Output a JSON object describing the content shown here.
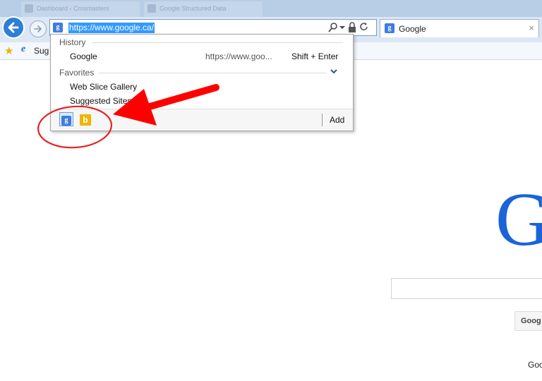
{
  "browser": {
    "background_tabs": [
      "Dashboard ‹ Cmsmasters",
      "Google Structured Data"
    ],
    "active_tab": {
      "title": "Google",
      "close_symbol": "×"
    },
    "address_bar": {
      "url": "https://www.google.ca/"
    },
    "favorites_bar": {
      "label": "Sug"
    }
  },
  "dropdown": {
    "history_header": "History",
    "history_item": {
      "label": "Google",
      "url": "https://www.goo...",
      "shortcut": "Shift + Enter"
    },
    "favorites_header": "Favorites",
    "favorites_items": [
      "Web Slice Gallery",
      "Suggested Sites"
    ],
    "add_label": "Add",
    "providers": [
      {
        "name": "google",
        "glyph": "g"
      },
      {
        "name": "bing",
        "glyph": "b"
      }
    ]
  },
  "page": {
    "logo_letter": "G",
    "search_button_label": "Goog",
    "footer_text": "Goo"
  },
  "colors": {
    "annotation_red": "#ff0000",
    "selection_blue": "#3399ff",
    "google_blue": "#1a63d8"
  }
}
